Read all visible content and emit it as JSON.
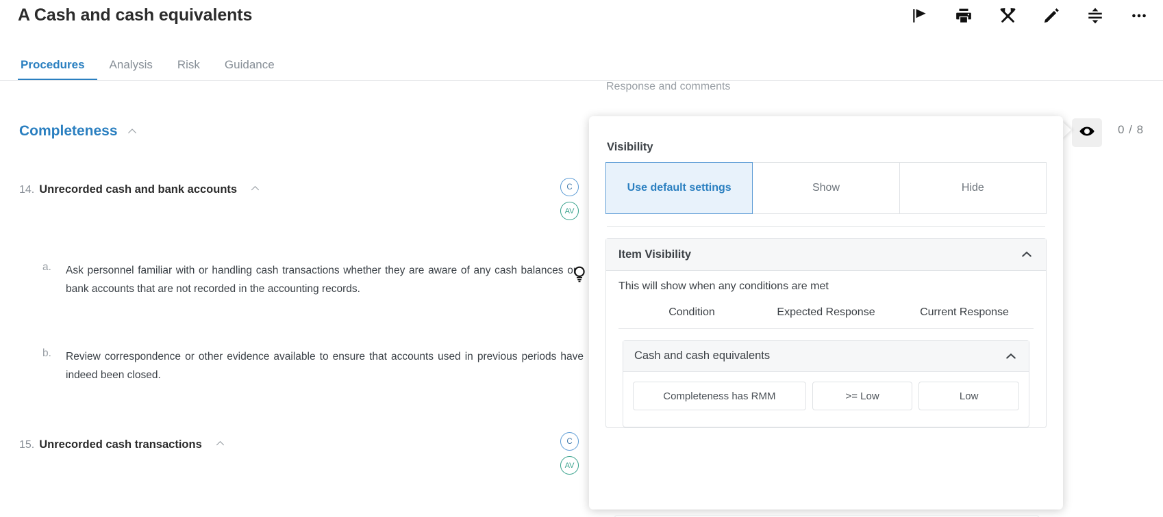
{
  "header": {
    "title": "A Cash and cash equivalents",
    "actions": [
      {
        "name": "flag-icon",
        "label": "Flag"
      },
      {
        "name": "print-icon",
        "label": "Print"
      },
      {
        "name": "tools-icon",
        "label": "Tools"
      },
      {
        "name": "pencil-icon",
        "label": "Edit"
      },
      {
        "name": "collapse-icon",
        "label": "Collapse"
      },
      {
        "name": "more-icon",
        "label": "More options"
      }
    ]
  },
  "tabs": [
    {
      "label": "Procedures",
      "active": true
    },
    {
      "label": "Analysis",
      "active": false
    },
    {
      "label": "Risk",
      "active": false
    },
    {
      "label": "Guidance",
      "active": false
    }
  ],
  "columns": {
    "response_and_comments": "Response and comments"
  },
  "section": {
    "title": "Completeness"
  },
  "procedures": [
    {
      "number": "14.",
      "title": "Unrecorded cash and bank accounts",
      "badges": [
        "C",
        "AV"
      ],
      "steps": [
        {
          "letter": "a.",
          "text": "Ask personnel familiar with or handling cash transactions whether they are aware of any cash balances or bank accounts that are not recorded in the accounting records."
        },
        {
          "letter": "b.",
          "text": "Review correspondence or other evidence available to ensure that accounts used in previous periods have indeed been closed."
        }
      ]
    },
    {
      "number": "15.",
      "title": "Unrecorded cash transactions",
      "badges": [
        "C",
        "AV"
      ],
      "steps": []
    }
  ],
  "visibility_counter": {
    "eye_icon": "eye-icon",
    "value": "0 / 8"
  },
  "popover": {
    "label": "Visibility",
    "mode_options": [
      {
        "label": "Use default settings",
        "selected": true
      },
      {
        "label": "Show",
        "selected": false
      },
      {
        "label": "Hide",
        "selected": false
      }
    ],
    "item_visibility": {
      "title": "Item Visibility",
      "note": "This will show when any conditions are met",
      "table_headers": {
        "condition": "Condition",
        "expected_response": "Expected Response",
        "current_response": "Current Response"
      },
      "groups": [
        {
          "title": "Cash and cash equivalents",
          "rows": [
            {
              "condition": "Completeness has RMM",
              "expected_response": ">= Low",
              "current_response": "Low"
            }
          ]
        }
      ]
    }
  },
  "colors": {
    "accent_blue": "#2a7fc0",
    "badge_c": "#5b9bd5",
    "badge_av": "#36a18b",
    "selected_bg": "#e8f2fb",
    "muted_text": "#868e96"
  }
}
